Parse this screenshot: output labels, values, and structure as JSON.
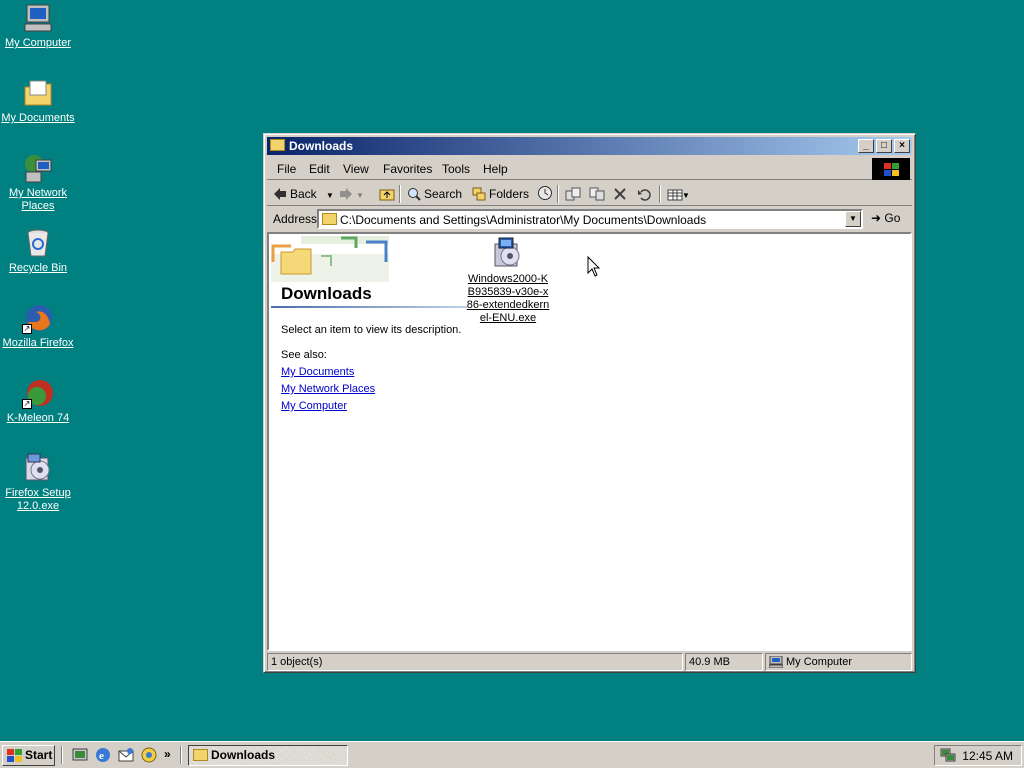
{
  "desktop": {
    "icons": [
      {
        "label": "My Computer"
      },
      {
        "label": "My Documents"
      },
      {
        "label": "My Network Places"
      },
      {
        "label": "Recycle Bin"
      },
      {
        "label": "Mozilla Firefox"
      },
      {
        "label": "K-Meleon 74"
      },
      {
        "label": "Firefox Setup 12.0.exe"
      }
    ]
  },
  "window": {
    "title": "Downloads",
    "menu": [
      "File",
      "Edit",
      "View",
      "Favorites",
      "Tools",
      "Help"
    ],
    "toolbar": {
      "back": "Back",
      "search": "Search",
      "folders": "Folders"
    },
    "address": {
      "label": "Address",
      "value": "C:\\Documents and Settings\\Administrator\\My Documents\\Downloads",
      "go": "Go"
    },
    "pane": {
      "title": "Downloads",
      "description": "Select an item to view its description.",
      "see_also": "See also:",
      "links": [
        "My Documents",
        "My Network Places",
        "My Computer"
      ]
    },
    "file": {
      "name": "Windows2000-KB935839-v30e-x86-extendedkernel-ENU.exe"
    },
    "status": {
      "objects": "1 object(s)",
      "size": "40.9 MB",
      "zone": "My Computer"
    }
  },
  "taskbar": {
    "start": "Start",
    "task": "Downloads",
    "clock": "12:45 AM"
  },
  "colors": {
    "desktop": "#008080",
    "titlebar_start": "#0a246a",
    "titlebar_end": "#a6caf0",
    "chrome": "#d4d0c8"
  }
}
